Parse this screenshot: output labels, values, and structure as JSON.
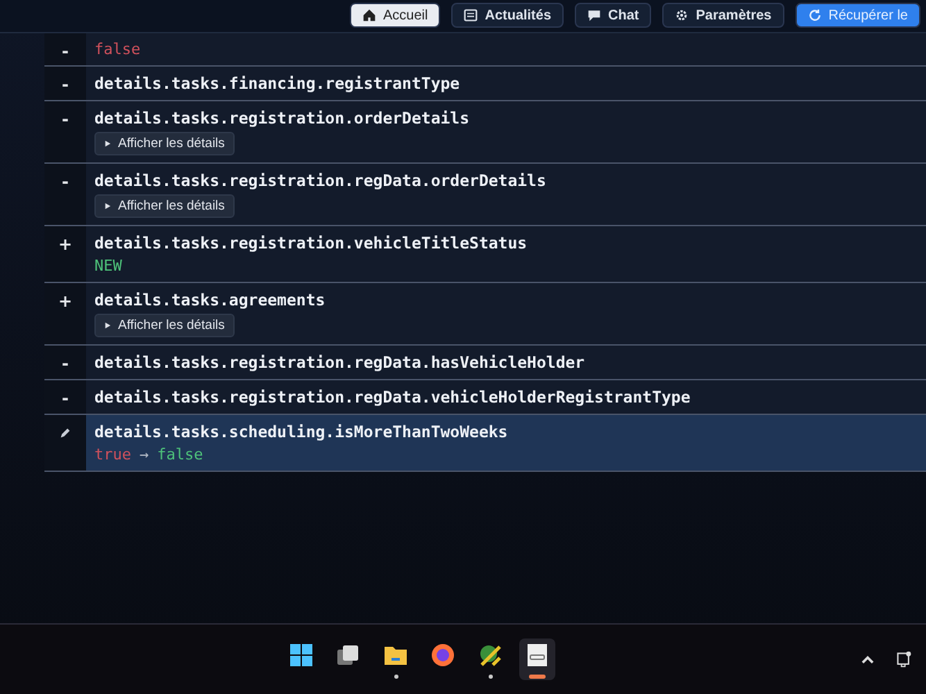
{
  "nav": [
    {
      "label": "Accueil",
      "selected": true
    },
    {
      "label": "Actualités",
      "selected": false
    },
    {
      "label": "Chat",
      "selected": false
    },
    {
      "label": "Paramètres",
      "selected": false
    },
    {
      "label": "Récupérer le",
      "selected": false,
      "kind": "primary"
    }
  ],
  "changes": [
    {
      "kind": "removed",
      "marker": "-",
      "value": {
        "old": "false"
      },
      "highlighted": false
    },
    {
      "kind": "removed",
      "marker": "-",
      "path": "details.tasks.financing.registrantType",
      "highlighted": false
    },
    {
      "kind": "removed",
      "marker": "-",
      "path": "details.tasks.registration.orderDetails",
      "details_button": "Afficher les détails",
      "highlighted": false
    },
    {
      "kind": "removed",
      "marker": "-",
      "path": "details.tasks.registration.regData.orderDetails",
      "details_button": "Afficher les détails",
      "highlighted": false
    },
    {
      "kind": "added",
      "marker": "+",
      "path": "details.tasks.registration.vehicleTitleStatus",
      "value": {
        "new": "NEW"
      },
      "highlighted": false
    },
    {
      "kind": "added",
      "marker": "+",
      "path": "details.tasks.agreements",
      "details_button": "Afficher les détails",
      "highlighted": false
    },
    {
      "kind": "removed",
      "marker": "-",
      "path": "details.tasks.registration.regData.hasVehicleHolder",
      "highlighted": false
    },
    {
      "kind": "removed",
      "marker": "-",
      "path": "details.tasks.registration.regData.vehicleHolderRegistrantType",
      "highlighted": false
    },
    {
      "kind": "changed",
      "path": "details.tasks.scheduling.isMoreThanTwoWeeks",
      "value": {
        "old": "true",
        "arrow": "→",
        "new": "false"
      },
      "highlighted": true
    }
  ],
  "taskbar": [
    {
      "running": false,
      "active": false
    },
    {
      "running": false,
      "active": false
    },
    {
      "running": true,
      "active": false
    },
    {
      "running": false,
      "active": false
    },
    {
      "running": true,
      "active": false
    },
    {
      "running": false,
      "active": true
    }
  ]
}
